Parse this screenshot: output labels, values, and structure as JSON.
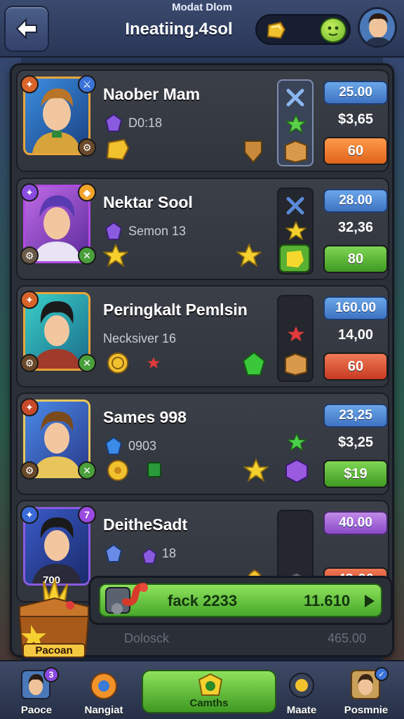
{
  "header": {
    "subtitle": "Modat Dlom",
    "title": "Ineatiing.4sol",
    "back_icon": "arrow-left-icon",
    "colors": {
      "accent_blue": "#3e73c2",
      "accent_green": "#47a82a",
      "accent_orange": "#e0631c"
    }
  },
  "rows": [
    {
      "name": "Naober Mam",
      "sub": "D0:18",
      "price_top": "25.00",
      "price_mid": "$3,65",
      "action": "60"
    },
    {
      "name": "Nektar Sool",
      "sub": "Semon 13",
      "price_top": "28.00",
      "price_mid": "32,36",
      "action": "80"
    },
    {
      "name": "Peringkalt Pemlsin",
      "sub": "Necksiver 16",
      "price_top": "160.00",
      "price_mid": "14,00",
      "action": "60"
    },
    {
      "name": "Sames 998",
      "sub": "0903",
      "price_top": "23,25",
      "price_mid": "$3,25",
      "action": "$19"
    },
    {
      "name": "DeitheSadt",
      "sub": "18",
      "price_top": "40.00",
      "price_mid": "",
      "action": "43:06"
    }
  ],
  "badges": {
    "row5_top": "7",
    "row5_bottom_text": "700"
  },
  "promo": {
    "label": "fack 2233",
    "value": "11.610",
    "chest_label": "Pacoan",
    "dimmed_left": "Dolosck",
    "dimmed_right": "465.00"
  },
  "nav": {
    "items": [
      {
        "label": "Paoce",
        "badge": "3"
      },
      {
        "label": "Nangiat"
      },
      {
        "label": "Camths"
      },
      {
        "label": "Maate"
      },
      {
        "label": "Posmnie"
      }
    ]
  }
}
